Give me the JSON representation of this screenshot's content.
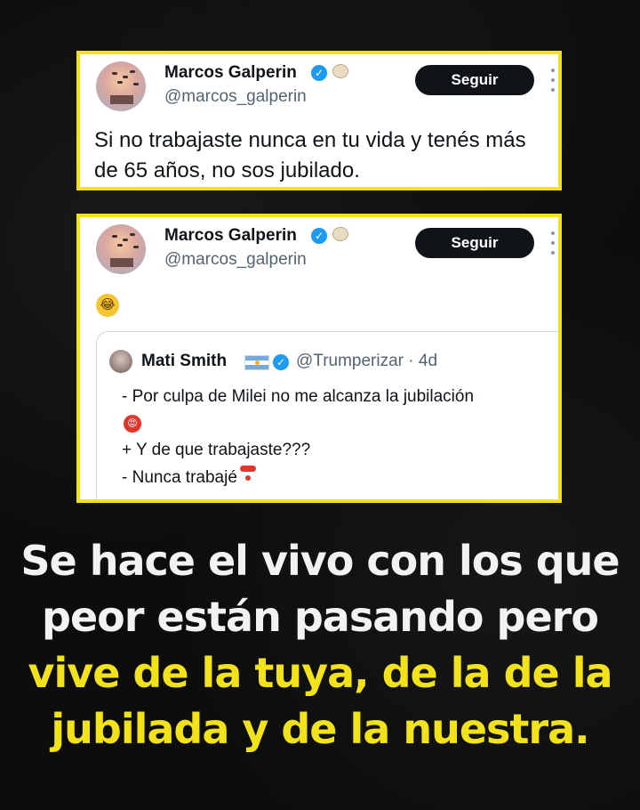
{
  "tweet1": {
    "name": "Marcos Galperin",
    "handle": "@marcos_galperin",
    "follow_label": "Seguir",
    "text": "Si no trabajaste nunca en tu vida y tenés más de 65 años, no sos jubilado."
  },
  "tweet2": {
    "name": "Marcos Galperin",
    "handle": "@marcos_galperin",
    "follow_label": "Seguir",
    "emoji_icon": "laughing-tears-emoji",
    "quote": {
      "name": "Mati Smith",
      "handle": "@Trumperizar · 4d",
      "lines": [
        "- Por culpa de Milei no me alcanza la jubilación",
        "+ Y de que trabajaste???",
        "- Nunca trabajé"
      ]
    }
  },
  "headline": {
    "white_line1": "Se hace el vivo con los que",
    "white_line2": "peor están pasando pero",
    "yellow_line1": "vive de la tuya, de la de la",
    "yellow_line2": "jubilada y de la nuestra."
  },
  "colors": {
    "background": "#0d0d0d",
    "highlight_yellow": "#f2e21a",
    "verified_blue": "#1d9bf0",
    "follow_button": "#0f1419"
  }
}
